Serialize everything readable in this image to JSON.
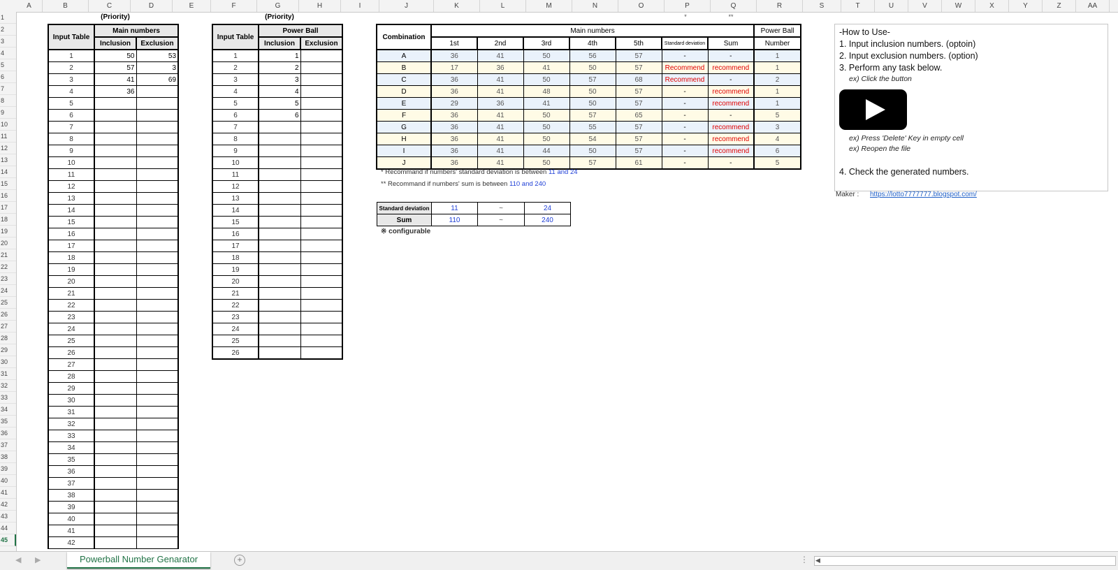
{
  "columns": [
    "A",
    "B",
    "C",
    "D",
    "E",
    "F",
    "G",
    "H",
    "I",
    "J",
    "K",
    "L",
    "M",
    "N",
    "O",
    "P",
    "Q",
    "R",
    "S",
    "T",
    "U",
    "V",
    "W",
    "X",
    "Y",
    "Z",
    "AA"
  ],
  "rows": [
    "1",
    "2",
    "3",
    "4",
    "5",
    "6",
    "7",
    "8",
    "9",
    "10",
    "11",
    "12",
    "13",
    "14",
    "15",
    "16",
    "17",
    "18",
    "19",
    "20",
    "21",
    "22",
    "23",
    "24",
    "25",
    "26",
    "27",
    "28",
    "29",
    "30",
    "31",
    "32",
    "33",
    "34",
    "35",
    "36",
    "37",
    "38",
    "39",
    "40",
    "41",
    "42",
    "43",
    "44",
    "45"
  ],
  "main_table": {
    "priority_label": "(Priority)",
    "input_table_label": "Input Table",
    "group_label": "Main numbers",
    "inclusion_label": "Inclusion",
    "exclusion_label": "Exclusion",
    "index": [
      "1",
      "2",
      "3",
      "4",
      "5",
      "6",
      "7",
      "8",
      "9",
      "10",
      "11",
      "12",
      "13",
      "14",
      "15",
      "16",
      "17",
      "18",
      "19",
      "20",
      "21",
      "22",
      "23",
      "24",
      "25",
      "26",
      "27",
      "28",
      "29",
      "30",
      "31",
      "32",
      "33",
      "34",
      "35",
      "36",
      "37",
      "38",
      "39",
      "40",
      "41",
      "42"
    ],
    "inclusion": [
      "50",
      "57",
      "41",
      "36"
    ],
    "exclusion": [
      "53",
      "3",
      "69"
    ]
  },
  "pb_table": {
    "priority_label": "(Priority)",
    "input_table_label": "Input Table",
    "group_label": "Power Ball",
    "inclusion_label": "Inclusion",
    "exclusion_label": "Exclusion",
    "index": [
      "1",
      "2",
      "3",
      "4",
      "5",
      "6",
      "7",
      "8",
      "9",
      "10",
      "11",
      "12",
      "13",
      "14",
      "15",
      "16",
      "17",
      "18",
      "19",
      "20",
      "21",
      "22",
      "23",
      "24",
      "25",
      "26"
    ],
    "inclusion": [
      "1",
      "2",
      "3",
      "4",
      "5",
      "6"
    ]
  },
  "combo": {
    "star1": "*",
    "star2": "**",
    "combination_label": "Combination",
    "main_label": "Main numbers",
    "pb_label_1": "Power Ball",
    "pb_label_2": "Number",
    "cols": [
      "1st",
      "2nd",
      "3rd",
      "4th",
      "5th",
      "Standard deviation",
      "Sum"
    ],
    "rows": [
      {
        "id": "A",
        "n": [
          "36",
          "41",
          "50",
          "56",
          "57"
        ],
        "sd": "-",
        "sum": "-",
        "pb": "1"
      },
      {
        "id": "B",
        "n": [
          "17",
          "36",
          "41",
          "50",
          "57"
        ],
        "sd": "Recommend",
        "sum": "recommend",
        "pb": "1"
      },
      {
        "id": "C",
        "n": [
          "36",
          "41",
          "50",
          "57",
          "68"
        ],
        "sd": "Recommend",
        "sum": "-",
        "pb": "2"
      },
      {
        "id": "D",
        "n": [
          "36",
          "41",
          "48",
          "50",
          "57"
        ],
        "sd": "-",
        "sum": "recommend",
        "pb": "1"
      },
      {
        "id": "E",
        "n": [
          "29",
          "36",
          "41",
          "50",
          "57"
        ],
        "sd": "-",
        "sum": "recommend",
        "pb": "1"
      },
      {
        "id": "F",
        "n": [
          "36",
          "41",
          "50",
          "57",
          "65"
        ],
        "sd": "-",
        "sum": "-",
        "pb": "5"
      },
      {
        "id": "G",
        "n": [
          "36",
          "41",
          "50",
          "55",
          "57"
        ],
        "sd": "-",
        "sum": "recommend",
        "pb": "3"
      },
      {
        "id": "H",
        "n": [
          "36",
          "41",
          "50",
          "54",
          "57"
        ],
        "sd": "-",
        "sum": "recommend",
        "pb": "4"
      },
      {
        "id": "I",
        "n": [
          "36",
          "41",
          "44",
          "50",
          "57"
        ],
        "sd": "-",
        "sum": "recommend",
        "pb": "6"
      },
      {
        "id": "J",
        "n": [
          "36",
          "41",
          "50",
          "57",
          "61"
        ],
        "sd": "-",
        "sum": "-",
        "pb": "5"
      }
    ],
    "note1_pre": "* Recommand if numbers' standard deviation is between ",
    "note1_a": "11",
    "note1_and": " and ",
    "note1_b": "24",
    "note2_pre": "** Recommand if numbers' sum is between ",
    "note2_a": "110",
    "note2_and": " and ",
    "note2_b": "240"
  },
  "config": {
    "sd_label": "Standard deviation",
    "sd_min": "11",
    "sd_max": "24",
    "sum_label": "Sum",
    "sum_min": "110",
    "sum_max": "240",
    "tilde": "~",
    "note": "※ configurable"
  },
  "howto": {
    "title": "-How to Use-",
    "s1": "1. Input inclusion numbers. (optoin)",
    "s2": "2. Input exclusion numbers. (option)",
    "s3": "3. Perform any task below.",
    "ex1": "ex) Click the button",
    "ex2": "ex) Press 'Delete' Key in empty cell",
    "ex3": "ex) Reopen the file",
    "s4": "4. Check the generated numbers.",
    "maker_label": "Maker :",
    "maker_link": "https://lotto7777777.blogspot.com/"
  },
  "sheet_tab": "Powerball Number Genarator",
  "colors": {
    "excel_green": "#217346",
    "red": "#e00000",
    "blue": "#1f3fd6",
    "row_blue": "#eaf2fb",
    "row_yellow": "#fffbe6"
  }
}
